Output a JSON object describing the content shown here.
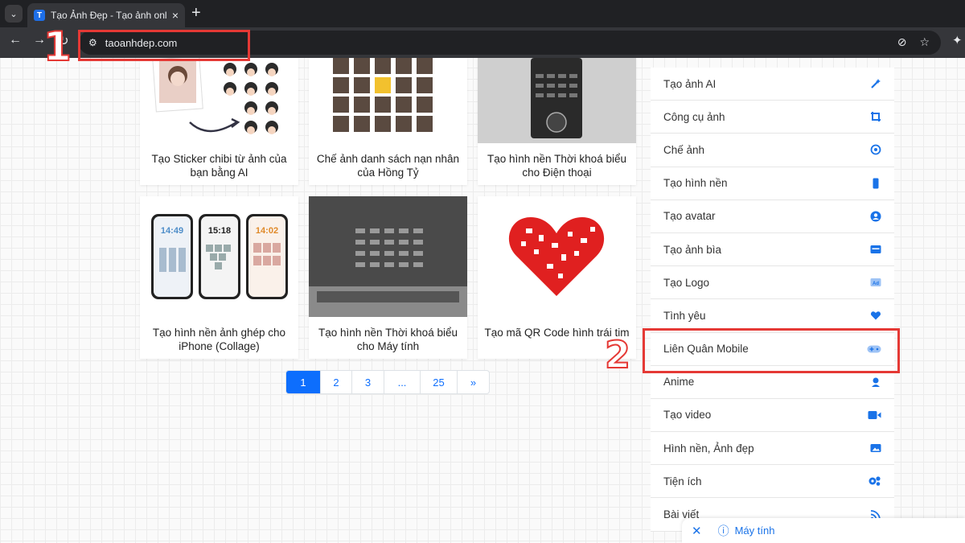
{
  "browser": {
    "tab_title": "Tạo Ảnh Đẹp - Tạo ảnh online v",
    "tab_favicon": "T",
    "url": "taoanhdep.com"
  },
  "cards": [
    {
      "title": "Tạo Sticker chibi từ ảnh của bạn bằng AI"
    },
    {
      "title": "Chế ảnh danh sách nạn nhân của Hồng Tỷ"
    },
    {
      "title": "Tạo hình nền Thời khoá biểu cho Điện thoại"
    },
    {
      "title": "Tạo hình nền ảnh ghép cho iPhone (Collage)",
      "phone_times": [
        "14:49",
        "15:18",
        "14:02"
      ]
    },
    {
      "title": "Tạo hình nền Thời khoá biểu cho Máy tính"
    },
    {
      "title": "Tạo mã QR Code hình trái tim"
    }
  ],
  "pagination": {
    "items": [
      "1",
      "2",
      "3",
      "...",
      "25",
      "»"
    ],
    "active": "1"
  },
  "menu": {
    "items": [
      {
        "label": "Tạo ảnh AI",
        "icon": "magic-wand-icon"
      },
      {
        "label": "Công cụ ảnh",
        "icon": "crop-icon"
      },
      {
        "label": "Chế ảnh",
        "icon": "photo-edit-icon"
      },
      {
        "label": "Tạo hình nền",
        "icon": "phone-icon"
      },
      {
        "label": "Tạo avatar",
        "icon": "user-circle-icon"
      },
      {
        "label": "Tạo ảnh bìa",
        "icon": "cover-icon"
      },
      {
        "label": "Tạo Logo",
        "icon": "ad-icon"
      },
      {
        "label": "Tình yêu",
        "icon": "heart-icon"
      },
      {
        "label": "Liên Quân Mobile",
        "icon": "gamepad-icon"
      },
      {
        "label": "Anime",
        "icon": "anime-icon"
      },
      {
        "label": "Tạo video",
        "icon": "video-icon"
      },
      {
        "label": "Hình nền, Ảnh đẹp",
        "icon": "image-icon"
      },
      {
        "label": "Tiện ích",
        "icon": "gears-icon"
      },
      {
        "label": "Bài viết",
        "icon": "rss-icon"
      }
    ]
  },
  "annotations": {
    "step1": "1",
    "step2": "2",
    "color": "#e53935"
  },
  "bottom_bar": {
    "label": "Máy tính"
  },
  "colors": {
    "accent": "#0d6efd",
    "menu_icon": "#1a73e8"
  }
}
